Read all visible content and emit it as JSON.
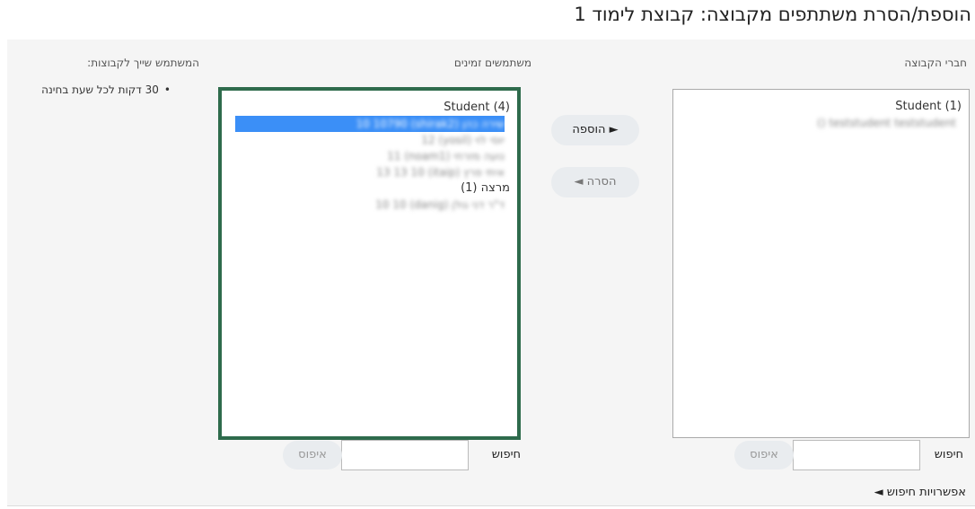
{
  "page_title": "הוספת/הסרת משתתפים מקבוצה: קבוצת לימוד 1",
  "headers": {
    "members": "חברי הקבוצה",
    "potential": "משתמשים זמינים",
    "user_groups": "המשתמש שייך לקבוצות:"
  },
  "members_list": {
    "group_label": "Student (1)",
    "items": [
      "teststudent teststudent ()"
    ]
  },
  "potential_list": {
    "groups": [
      {
        "label": "Student (4)",
        "items": [
          {
            "text": "שירה כהן (shirak2) 10 10790",
            "selected": true
          },
          {
            "text": "יוסי לוי (yosil) 12",
            "selected": false
          },
          {
            "text": "נועה מזרחי (noam1) 11",
            "selected": false
          },
          {
            "text": "איתי פרץ (itaip) 13 13 10",
            "selected": false
          }
        ]
      },
      {
        "label": "מרצה (1)",
        "items": [
          {
            "text": "ד\"ר דני גולן (danig) 10 10",
            "selected": false
          }
        ]
      }
    ]
  },
  "buttons": {
    "add": "► הוספה",
    "remove": "הסרה ◄"
  },
  "search": {
    "label": "חיפוש",
    "reset": "איפוס",
    "options_link": "אפשרויות חיפוש ◄"
  },
  "user_groups_list": [
    "30 דקות לכל שעת בחינה"
  ]
}
